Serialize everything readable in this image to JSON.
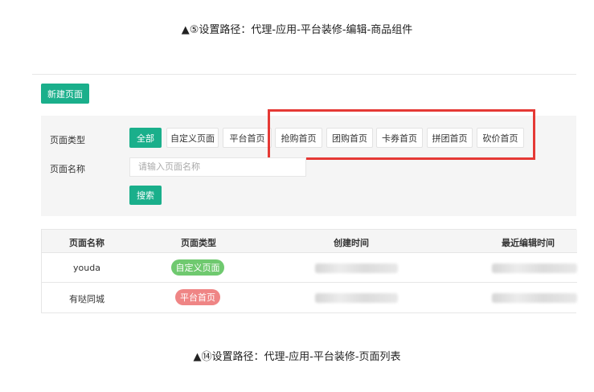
{
  "caption_top": "▲⑤设置路径：代理-应用-平台装修-编辑-商品组件",
  "caption_bottom": "▲⑭设置路径：代理-应用-平台装修-页面列表",
  "toolbar": {
    "new_page_label": "新建页面"
  },
  "filter": {
    "type_label": "页面类型",
    "type_options": [
      "全部",
      "自定义页面",
      "平台首页",
      "抢购首页",
      "团购首页",
      "卡券首页",
      "拼团首页",
      "砍价首页"
    ],
    "selected_type": "全部",
    "name_label": "页面名称",
    "name_placeholder": "请输入页面名称",
    "search_label": "搜索"
  },
  "table": {
    "headers": [
      "页面名称",
      "页面类型",
      "创建时间",
      "最近编辑时间"
    ],
    "rows": [
      {
        "name": "youda",
        "type": "自定义页面",
        "type_color": "#6fc96f"
      },
      {
        "name": "有哒同城",
        "type": "平台首页",
        "type_color": "#ef8585"
      }
    ]
  },
  "colors": {
    "accent": "#1aaf8b",
    "highlight": "#e53935"
  }
}
